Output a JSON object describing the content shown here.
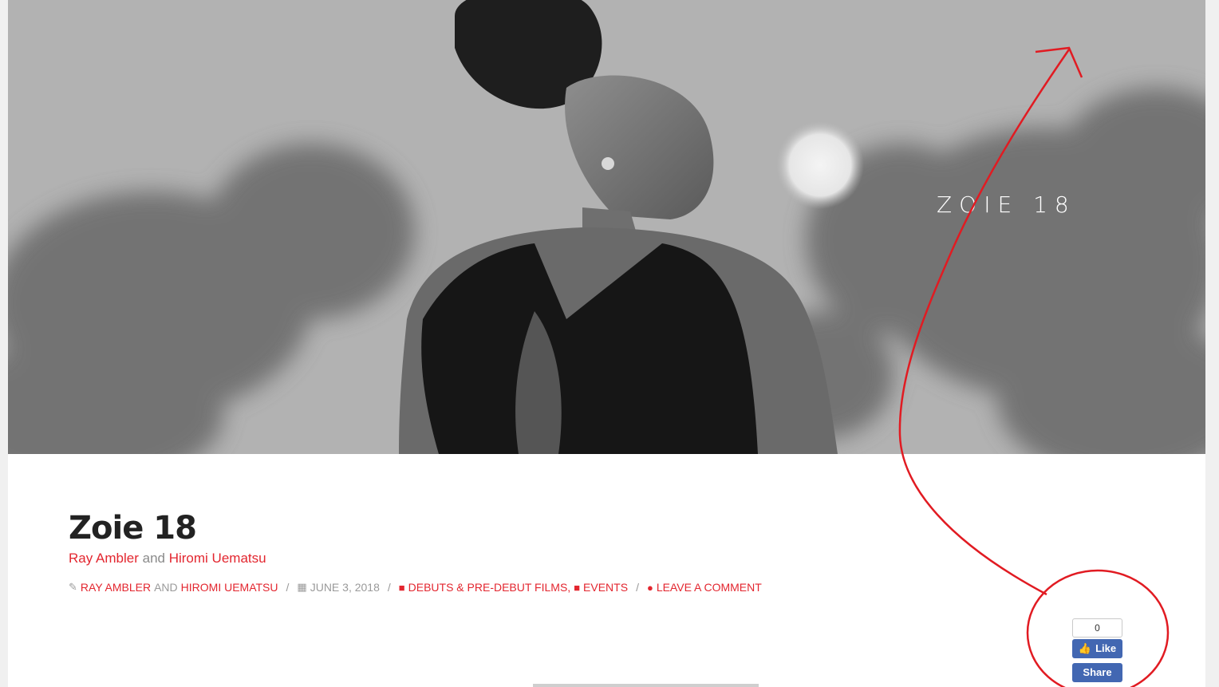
{
  "hero": {
    "overlay_title": "ZOIE 18",
    "image_alt": "Woman in black halter dress looking over her shoulder at dusk"
  },
  "post": {
    "title": "Zoie 18",
    "byline": {
      "author1": "Ray Ambler",
      "joiner": "and",
      "author2": "Hiromi Uematsu"
    },
    "meta": {
      "author1": "RAY AMBLER",
      "and": "AND",
      "author2": "HIROMI UEMATSU",
      "date": "JUNE 3, 2018",
      "category1": "DEBUTS & PRE-DEBUT FILMS,",
      "category2": "EVENTS",
      "comment": "LEAVE A COMMENT",
      "separator": "/"
    }
  },
  "facebook": {
    "count": "0",
    "like_label": "Like",
    "share_label": "Share"
  },
  "icons": {
    "author": "pencil-icon",
    "date": "calendar-icon",
    "category": "bookmark-icon",
    "comment": "comments-icon",
    "like": "thumbs-up-icon"
  },
  "colors": {
    "accent": "#e3262f",
    "facebook": "#4267b2",
    "annotation": "#e11b22"
  }
}
